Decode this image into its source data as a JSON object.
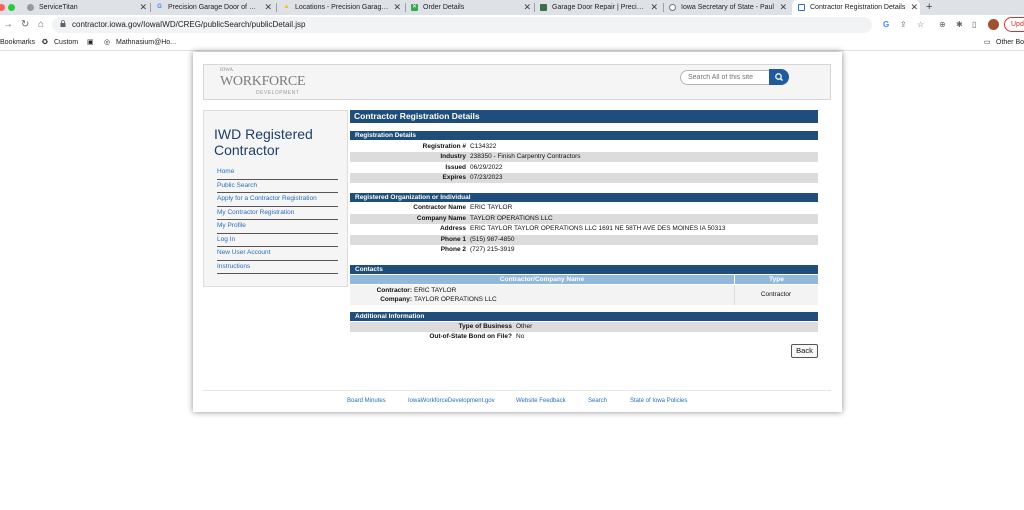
{
  "browser": {
    "tabs": [
      {
        "label": "ServiceTitan",
        "icon": "servicetitan-icon",
        "color": "#888888"
      },
      {
        "label": "Precision Garage Door of Des M",
        "icon": "google-icon",
        "color": "#4285f4"
      },
      {
        "label": "Locations - Precision Garage D",
        "icon": "google-ads-icon",
        "color": "#fbbc04"
      },
      {
        "label": "Order Details",
        "icon": "sheet-icon",
        "color": "#34a853"
      },
      {
        "label": "Garage Door Repair | Precision",
        "icon": "garage-icon",
        "color": "#3c6e47"
      },
      {
        "label": "Iowa Secretary of State - Paul",
        "icon": "seal-icon",
        "color": "#6d6d6d"
      },
      {
        "label": "Contractor Registration Details",
        "icon": "page-icon",
        "color": "#2a6ebb"
      }
    ],
    "url": "contractor.iowa.gov/IowaIWD/CREG/publicSearch/publicDetail.jsp",
    "update_label": "Upd",
    "bookmarks": [
      {
        "label": "Bookmarks"
      },
      {
        "label": "Custom"
      },
      {
        "label": ""
      },
      {
        "label": "Mathnasium@Ho..."
      },
      {
        "label": "Other Bo"
      }
    ]
  },
  "site": {
    "logo_small": "IOWA",
    "logo": "WORKFORCE",
    "logo_sub": "DEVELOPMENT",
    "search_placeholder": "Search All of this site"
  },
  "sidebar": {
    "title": "IWD Registered Contractor",
    "items": [
      "Home",
      "Public Search",
      "Apply for a Contractor Registration",
      "My Contractor Registration",
      "My Profile",
      "Log In",
      "New User Account",
      "Instructions"
    ]
  },
  "main": {
    "title": "Contractor Registration Details",
    "registration_details": {
      "heading": "Registration Details",
      "rows": [
        {
          "label": "Registration #",
          "value": "C134322"
        },
        {
          "label": "Industry",
          "value": "238350 - Finish Carpentry Contractors"
        },
        {
          "label": "Issued",
          "value": "06/29/2022"
        },
        {
          "label": "Expires",
          "value": "07/23/2023"
        }
      ]
    },
    "organization": {
      "heading": "Registered Organization or Individual",
      "rows": [
        {
          "label": "Contractor Name",
          "value": "ERIC TAYLOR"
        },
        {
          "label": "Company Name",
          "value": "TAYLOR OPERATIONS LLC"
        },
        {
          "label": "Address",
          "value": "ERIC TAYLOR TAYLOR OPERATIONS LLC 1691 NE 58TH AVE DES MOINES IA 50313"
        },
        {
          "label": "Phone 1",
          "value": "(515) 987-4850"
        },
        {
          "label": "Phone 2",
          "value": "(727) 215-3919"
        }
      ]
    },
    "contacts": {
      "heading": "Contacts",
      "col1": "Contractor/Company Name",
      "col2": "Type",
      "contractor_label": "Contractor:",
      "contractor_value": "ERIC TAYLOR",
      "company_label": "Company:",
      "company_value": "TAYLOR OPERATIONS LLC",
      "type": "Contractor"
    },
    "additional": {
      "heading": "Additional Information",
      "rows": [
        {
          "label": "Type of Business",
          "value": "Other"
        },
        {
          "label": "Out-of-State Bond on File?",
          "value": "No"
        }
      ]
    },
    "back_label": "Back"
  },
  "footer": {
    "links": [
      "Board Minutes",
      "IowaWorkforceDevelopment.gov",
      "Website Feedback",
      "Search",
      "State of Iowa Policies"
    ]
  }
}
